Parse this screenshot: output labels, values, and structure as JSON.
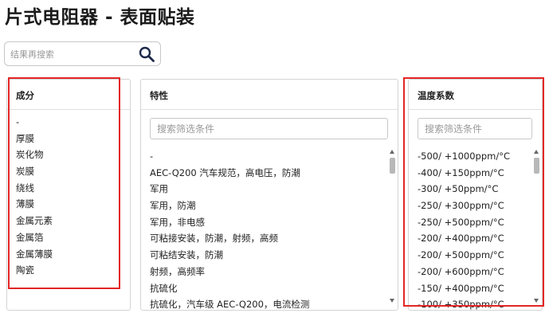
{
  "page": {
    "title": "片式电阻器 - 表面贴装",
    "search_placeholder": "结果再搜索"
  },
  "panels": {
    "composition": {
      "title": "成分",
      "items": [
        "-",
        "厚膜",
        "炭化物",
        "炭膜",
        "绕线",
        "薄膜",
        "金属元素",
        "金属箔",
        "金属薄膜",
        "陶瓷"
      ]
    },
    "features": {
      "title": "特性",
      "filter_placeholder": "搜索筛选条件",
      "items": [
        "-",
        "AEC-Q200 汽车规范，高电压，防潮",
        "军用",
        "军用，防潮",
        "军用，非电感",
        "可粘接安装，防潮，射频，高频",
        "可粘结安装，防潮",
        "射频，高频率",
        "抗硫化",
        "抗硫化，汽车级 AEC-Q200，电流检测"
      ]
    },
    "temp_coefficient": {
      "title": "温度系数",
      "filter_placeholder": "搜索筛选条件",
      "items": [
        "-500/ +1000ppm/°C",
        "-400/ +150ppm/°C",
        "-300/ +50ppm/°C",
        "-250/ +300ppm/°C",
        "-250/ +500ppm/°C",
        "-200/ +400ppm/°C",
        "-200/ +500ppm/°C",
        "-200/ +600ppm/°C",
        "-150/ +400ppm/°C",
        "-100/ +350ppm/°C"
      ]
    }
  },
  "colors": {
    "highlight": "#e32626",
    "border": "#d4d4d4"
  }
}
